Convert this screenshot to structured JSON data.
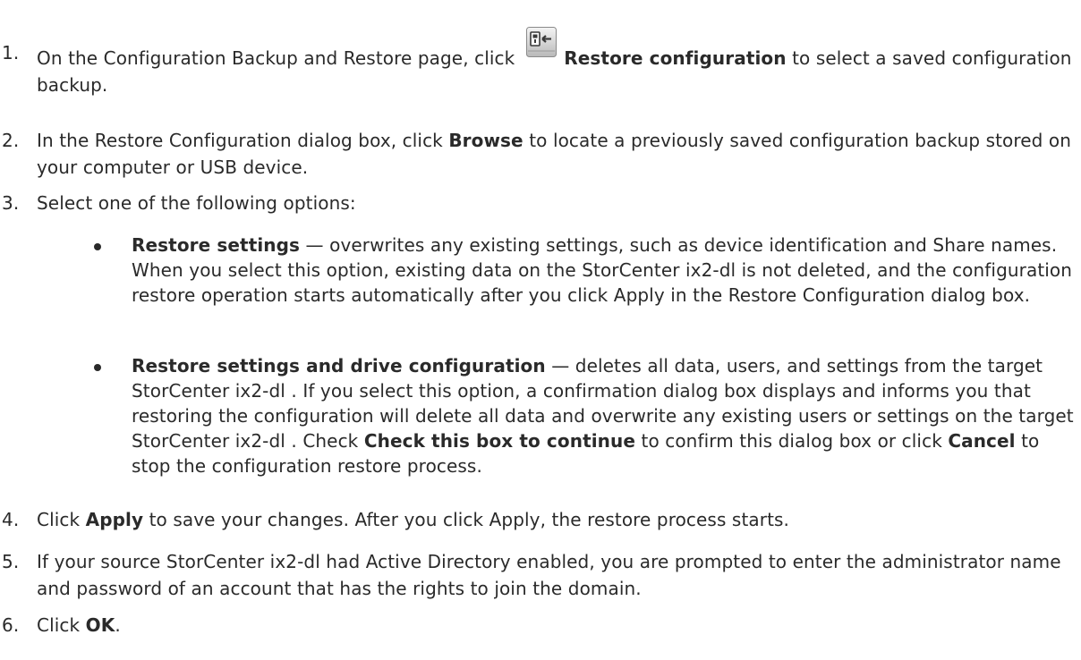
{
  "steps": [
    {
      "number": "1.",
      "pre": "On the Configuration Backup and Restore page, click",
      "bold": "Restore configuration",
      "post": "to select a saved configuration backup.",
      "icon": "restore-configuration-icon"
    },
    {
      "number": "2.",
      "pre": "In the Restore Configuration dialog box, click",
      "bold": "Browse",
      "post": "to locate a previously saved configuration backup stored on your computer or USB device."
    },
    {
      "number": "3.",
      "text": "Select one of the following options:"
    },
    {
      "number": "4.",
      "pre": "Click",
      "bold": "Apply",
      "post": "to save your changes. After you click Apply, the restore process starts."
    },
    {
      "number": "5.",
      "text": "If your source StorCenter ix2-dl had Active Directory enabled, you are prompted to enter the administrator name and password of an account that has the rights to join the domain."
    },
    {
      "number": "6.",
      "pre": "Click",
      "bold": "OK",
      "post": "."
    }
  ],
  "options": [
    {
      "bold": "Restore settings",
      "text": "— overwrites any existing settings, such as device identification and Share names. When you select this option, existing data on the StorCenter ix2-dl is not deleted, and the configuration restore operation starts automatically after you click Apply in the Restore Configuration dialog box."
    },
    {
      "bold": "Restore settings and drive configuration",
      "text1": "— deletes all data, users, and settings from the target StorCenter ix2-dl . If you select this option, a confirmation dialog box displays and informs you that restoring the configuration will delete all data and overwrite any existing users or settings on the target StorCenter ix2-dl . Check",
      "bold2": "Check this box to continue",
      "text2": "to confirm this dialog box or click",
      "bold3": "Cancel",
      "text3": "to stop the configuration restore process."
    }
  ]
}
